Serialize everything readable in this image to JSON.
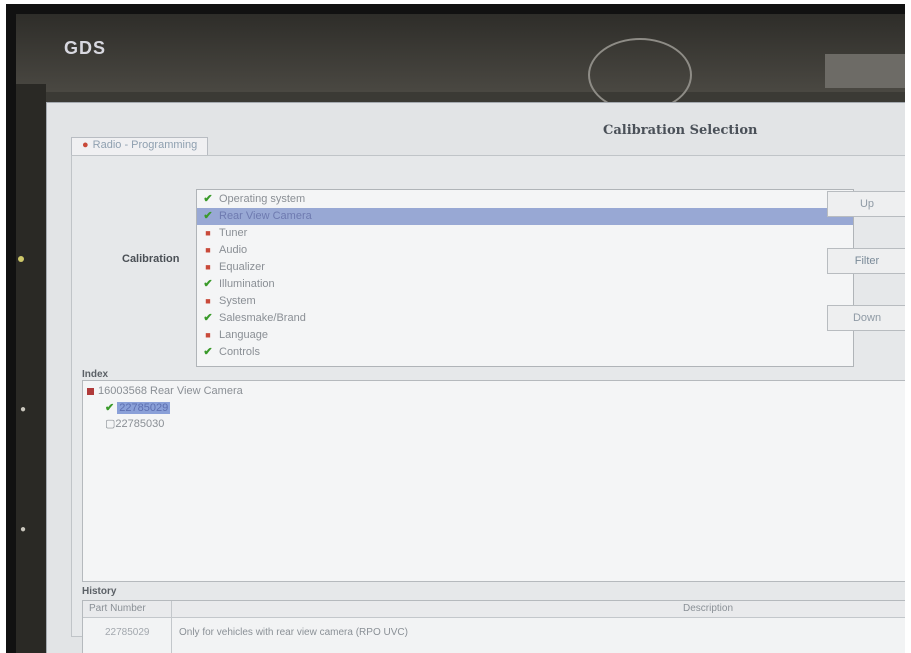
{
  "app": {
    "logo": "GDS",
    "dialog_title": "Calibration Selection",
    "tab_label": "Radio - Programming"
  },
  "calibration": {
    "label": "Calibration",
    "items": [
      {
        "label": "Operating system",
        "status": "done",
        "selected": false
      },
      {
        "label": "Rear View Camera",
        "status": "done",
        "selected": true
      },
      {
        "label": "Tuner",
        "status": "pending",
        "selected": false
      },
      {
        "label": "Audio",
        "status": "pending",
        "selected": false
      },
      {
        "label": "Equalizer",
        "status": "pending",
        "selected": false
      },
      {
        "label": "Illumination",
        "status": "done",
        "selected": false
      },
      {
        "label": "System",
        "status": "pending",
        "selected": false
      },
      {
        "label": "Salesmake/Brand",
        "status": "done",
        "selected": false
      },
      {
        "label": "Language",
        "status": "pending",
        "selected": false
      },
      {
        "label": "Controls",
        "status": "done",
        "selected": false
      }
    ],
    "buttons": {
      "up": "Up",
      "filter": "Filter",
      "down": "Down"
    }
  },
  "index": {
    "label": "Index",
    "root": "16003568 Rear View Camera",
    "children": [
      {
        "label": "22785029",
        "selected": true
      },
      {
        "label": "22785030",
        "selected": false
      }
    ]
  },
  "history": {
    "label": "History",
    "columns": [
      "Part Number",
      "Description"
    ],
    "rows": [
      {
        "part_number": "22785029",
        "description": "Only for vehicles with rear view camera (RPO UVC)"
      }
    ]
  },
  "colors": {
    "selection": "#98a8d4",
    "check": "#3a9a2a",
    "pending": "#c94a3a"
  }
}
